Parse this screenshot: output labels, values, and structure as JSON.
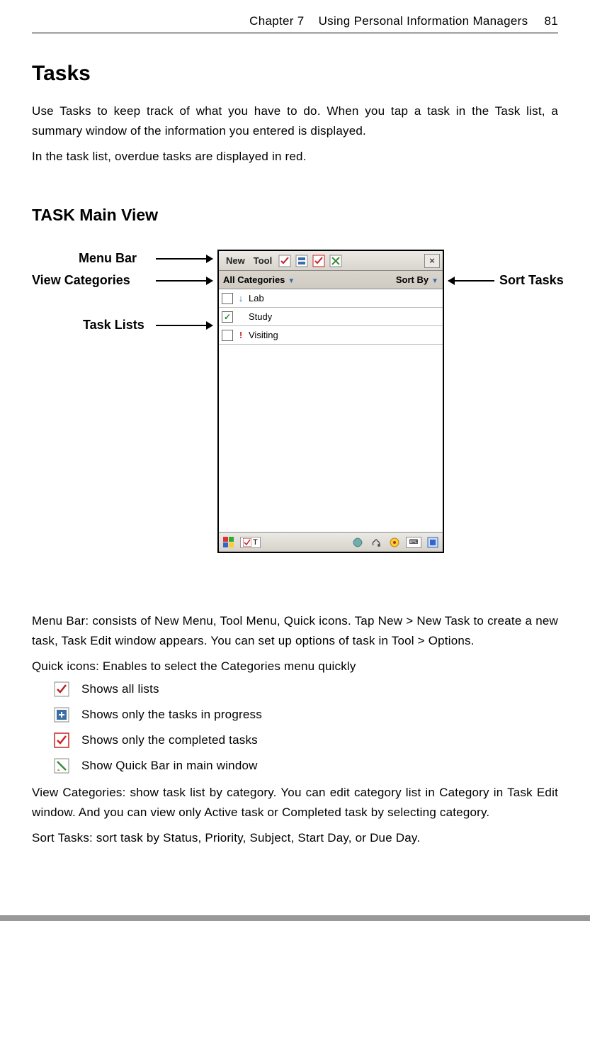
{
  "header": {
    "chapter": "Chapter 7",
    "title": "Using Personal Information Managers",
    "page": "81"
  },
  "section_title": "Tasks",
  "intro_p1": "Use Tasks to keep track of what you have to do. When you tap a task in the Task list, a summary window of the information you entered is displayed.",
  "intro_p2": "In the task list, overdue tasks are displayed in red.",
  "subsection_title": "TASK Main View",
  "callouts": {
    "menu_bar": "Menu Bar",
    "view_categories": "View Categories",
    "task_lists": "Task Lists",
    "sort_tasks": "Sort Tasks"
  },
  "pda": {
    "menu_new": "New",
    "menu_tool": "Tool",
    "category_label": "All Categories",
    "sort_label": "Sort By",
    "tasks": [
      {
        "checked": false,
        "priority": "low",
        "label": "Lab"
      },
      {
        "checked": true,
        "priority": "none",
        "label": "Study"
      },
      {
        "checked": false,
        "priority": "high",
        "label": "Visiting"
      }
    ],
    "bottom_label": "T"
  },
  "desc_menubar": "Menu Bar: consists of New Menu, Tool Menu, Quick icons. Tap New > New Task to create a new task, Task Edit window appears. You can set up options of task in Tool > Options.",
  "desc_quickicons_intro": "Quick icons: Enables to select the Categories menu quickly",
  "quick_icons": [
    {
      "name": "shows-all-lists",
      "text": "Shows all lists"
    },
    {
      "name": "shows-in-progress",
      "text": "Shows only the tasks in progress"
    },
    {
      "name": "shows-completed",
      "text": "Shows only the completed tasks"
    },
    {
      "name": "show-quick-bar",
      "text": "Show Quick Bar in main window"
    }
  ],
  "desc_view_categories": "View Categories: show task list by category. You can edit category list in Category in Task Edit window. And you can view only Active task or Completed task by selecting category.",
  "desc_sort_tasks": "Sort Tasks: sort task by Status, Priority, Subject, Start Day, or Due Day."
}
